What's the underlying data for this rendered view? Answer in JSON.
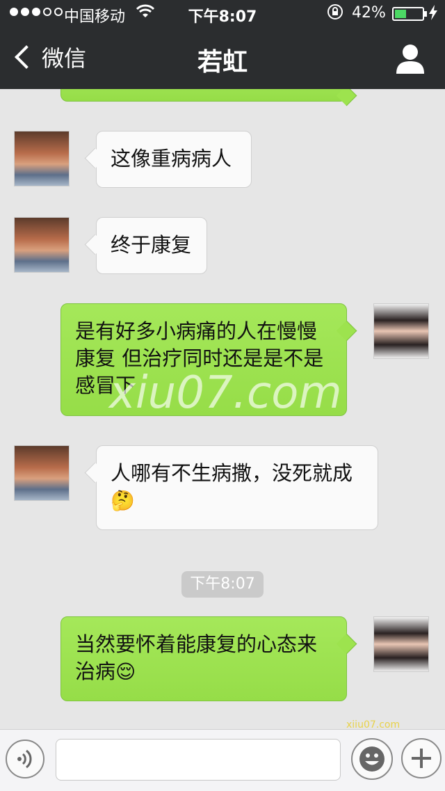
{
  "status_bar": {
    "carrier": "中国移动",
    "time": "下午8:07",
    "battery_text": "42%",
    "battery_level": 0.42,
    "wifi_icon": "wifi-icon",
    "lock_icon": "rotation-lock-icon",
    "charge_icon": "charging-bolt-icon"
  },
  "nav": {
    "back_label": "微信",
    "title": "若虹",
    "profile_icon": "person-icon"
  },
  "messages": [
    {
      "side": "left",
      "text": "这像重病病人"
    },
    {
      "side": "left",
      "text": "终于康复"
    },
    {
      "side": "right",
      "text": "是有好多小病痛的人在慢慢康复 但治疗同时还是是不是感冒下"
    },
    {
      "side": "left",
      "text": "人哪有不生病撒，没死就成",
      "emoji": "🤔"
    },
    {
      "side": "right",
      "text": "当然要怀着能康复的心态来治病",
      "emoji": "😌"
    }
  ],
  "time_divider": "下午8:07",
  "watermark": "xiu07.com",
  "watermark_small": "xiiu07.com",
  "input_bar": {
    "voice_icon": "voice-icon",
    "text_value": "",
    "emoji_icon": "smiley-icon",
    "plus_icon": "plus-icon"
  },
  "colors": {
    "bar_bg": "#2b2d2f",
    "chat_bg": "#e6e6e6",
    "bubble_green": "#9ee550",
    "bubble_white": "#fafafa"
  }
}
